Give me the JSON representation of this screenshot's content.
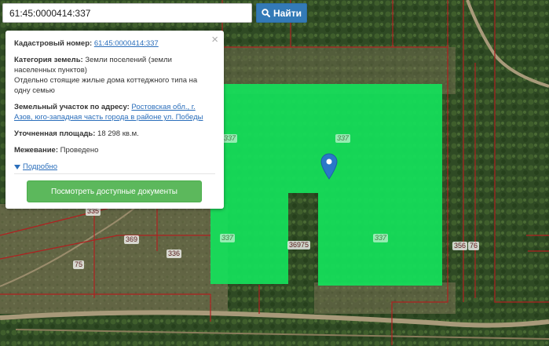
{
  "search": {
    "value": "61:45:0000414:337",
    "button_label": "Найти"
  },
  "popup": {
    "cadastral_label": "Кадастровый номер:",
    "cadastral_value": "61:45:0000414:337",
    "category_label": "Категория земель:",
    "category_line1": "Земли поселений (земли",
    "category_line2": "населенных пунктов)",
    "usage_line1": "Отдельно стоящие жилые дома коттеджного типа на",
    "usage_line2": "одну семью",
    "address_label": "Земельный участок по адресу:",
    "address_line1": "Ростовская обл., г.",
    "address_line2": "Азов, юго-западная часть города в районе ул. Победы",
    "area_label": "Уточненная площадь:",
    "area_value": "18 298 кв.м.",
    "survey_label": "Межевание:",
    "survey_value": "Проведено",
    "more_label": "Подробно",
    "docs_button": "Посмотреть доступные документы",
    "close_symbol": "×"
  },
  "map": {
    "parcel_labels": {
      "l337_left": "337",
      "l337_top": "337",
      "l337_bottom_left": "337",
      "l337_bottom_right": "337",
      "l36975": "36975",
      "l335": "335",
      "l369": "369",
      "l336": "336",
      "l75": "75",
      "l356": "356",
      "l76": "76"
    },
    "colors": {
      "parcel_fill": "#14e05a",
      "boundary": "#b02020",
      "marker": "#2a78c8"
    }
  }
}
